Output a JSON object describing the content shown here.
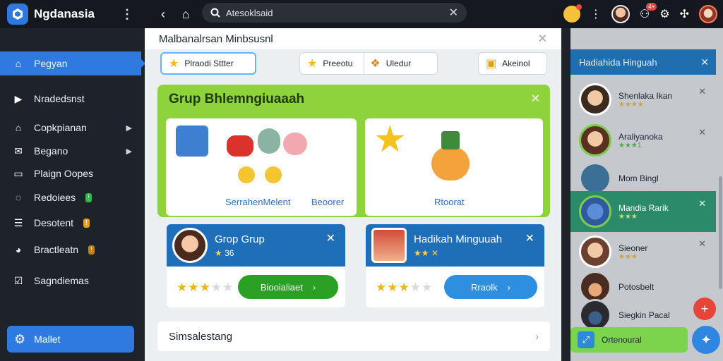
{
  "app": {
    "title": "Ngdanasia"
  },
  "search": {
    "query": "Atesoklsaid"
  },
  "topbar": {
    "notif_badge": "4+"
  },
  "sidebar": {
    "items": [
      {
        "label": "Pegyan",
        "icon": "home-icon"
      },
      {
        "label": "Nradedsnst",
        "icon": "play-icon"
      },
      {
        "label": "Copkpianan",
        "icon": "house-icon"
      },
      {
        "label": "Begano",
        "icon": "mail-icon"
      },
      {
        "label": "Plaign Oopes",
        "icon": "folder-icon"
      },
      {
        "label": "Redoiees",
        "icon": "chat-icon",
        "tag": "!"
      },
      {
        "label": "Desotent",
        "icon": "list-icon",
        "tag": "!"
      },
      {
        "label": "Bractleatn",
        "icon": "pie-icon",
        "tag": "!"
      },
      {
        "label": "Sagndiemas",
        "icon": "check-icon"
      }
    ],
    "footer_label": "Mallet"
  },
  "main": {
    "header": "Malbanalrsan Minbsusnl",
    "tabs": [
      {
        "label": "Plraodi Sttter",
        "icon": "star-icon"
      },
      {
        "label": "Preeotu",
        "icon": "star-icon"
      },
      {
        "label": "Uledur",
        "icon": "gift-icon"
      },
      {
        "label": "Akeinol",
        "icon": "frame-icon"
      }
    ],
    "group_title": "Grup Bhlemngiuaaah",
    "cards": [
      {
        "label": "SerrahenMelent"
      },
      {
        "label": "Beoorer"
      },
      {
        "label": "Rtoorat"
      }
    ],
    "players": [
      {
        "name": "Grop Grup",
        "score": "36",
        "rating": 3,
        "button": "Biooialiaet",
        "button_color": "#2aa024"
      },
      {
        "name": "Hadikah Minguuah",
        "score": "",
        "rating": 3,
        "button": "Rraolk",
        "button_color": "#2e8ee0"
      }
    ],
    "setting": "Simsalestang"
  },
  "right": {
    "header": "Hadiahida Hinguah",
    "items": [
      {
        "name": "Shenlaka Ikan",
        "stars": "★★★★",
        "closable": true
      },
      {
        "name": "Araliyanoka",
        "stars": "★★★1",
        "closable": true
      },
      {
        "name": "Mom Bingl",
        "stars": "",
        "closable": false
      },
      {
        "name": "Mandia Rarik",
        "stars": "★★★",
        "closable": true,
        "selected": true
      },
      {
        "name": "Sieoner",
        "stars": "★★★",
        "closable": true
      },
      {
        "name": "Potosbelt",
        "stars": "",
        "closable": false
      },
      {
        "name": "Siegkin Pacal",
        "stars": "",
        "closable": false
      }
    ],
    "footer": "Ortenoural"
  }
}
